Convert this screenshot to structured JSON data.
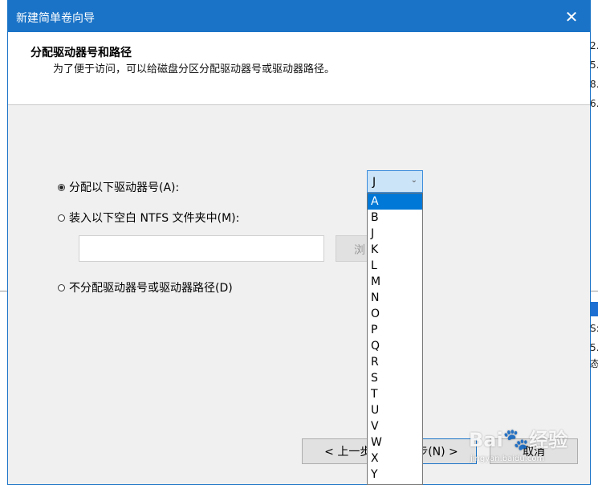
{
  "dialog": {
    "title": "新建简单卷向导",
    "close_icon": "✕",
    "header_title": "分配驱动器号和路径",
    "header_subtitle": "为了便于访问，可以给磁盘分区分配驱动器号或驱动器路径。"
  },
  "options": {
    "assign_letter_label": "分配以下驱动器号(A):",
    "mount_folder_label": "装入以下空白 NTFS 文件夹中(M):",
    "no_assign_label": "不分配驱动器号或驱动器路径(D)"
  },
  "drive_select": {
    "value": "J",
    "chevron": "⌄"
  },
  "drive_list": [
    "A",
    "B",
    "J",
    "K",
    "L",
    "M",
    "N",
    "O",
    "P",
    "Q",
    "R",
    "S",
    "T",
    "U",
    "V",
    "W",
    "X",
    "Y"
  ],
  "drive_list_selected": "A",
  "browse_label": "浏",
  "path_input_value": "",
  "buttons": {
    "back": "< 上一步(",
    "next": "步(N) >",
    "cancel": "取消"
  },
  "watermark": {
    "logo_text": "Bai",
    "logo_suffix": "经验",
    "url": "jingyan.baidu.com"
  },
  "background": {
    "left_frags": [
      "",
      "",
      "",
      "",
      "",
      "",
      "",
      "",
      "",
      "",
      "",
      "",
      "",
      ""
    ],
    "right_frags": [
      "7.",
      "1.",
      "2.",
      "5.",
      "8.",
      "6."
    ],
    "right_lower_frags": [
      "S:",
      "5.",
      "态"
    ]
  },
  "colors": {
    "accent": "#1a73c7",
    "selection": "#0078d7",
    "select_bg": "#cce4f7"
  }
}
